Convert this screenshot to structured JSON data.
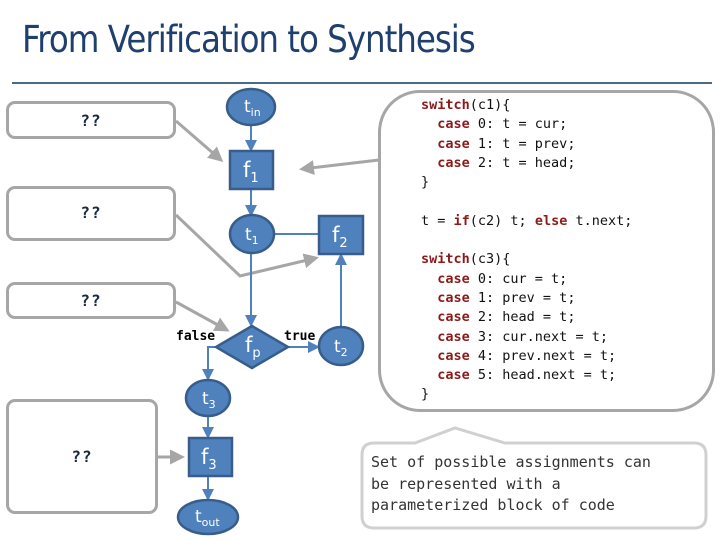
{
  "slide": {
    "title": "From Verification to Synthesis"
  },
  "holes": [
    {
      "label": "??"
    },
    {
      "label": "??"
    },
    {
      "label": "??"
    },
    {
      "label": "??"
    }
  ],
  "nodes": {
    "t_in": {
      "base": "t",
      "sub": "in"
    },
    "f1": {
      "base": "f",
      "sub": "1"
    },
    "t1": {
      "base": "t",
      "sub": "1"
    },
    "f2": {
      "base": "f",
      "sub": "2"
    },
    "fp": {
      "base": "f",
      "sub": "p"
    },
    "t2": {
      "base": "t",
      "sub": "2"
    },
    "t3": {
      "base": "t",
      "sub": "3"
    },
    "f3": {
      "base": "f",
      "sub": "3"
    },
    "t_out": {
      "base": "t",
      "sub": "out"
    }
  },
  "edge_labels": {
    "false": "false",
    "true": "true"
  },
  "code_block": {
    "lines": [
      [
        {
          "t": "switch",
          "kw": true
        },
        {
          "t": "(c1){"
        }
      ],
      [
        {
          "t": "  "
        },
        {
          "t": "case",
          "kw": true
        },
        {
          "t": " 0: t = cur;"
        }
      ],
      [
        {
          "t": "  "
        },
        {
          "t": "case",
          "kw": true
        },
        {
          "t": " 1: t = prev;"
        }
      ],
      [
        {
          "t": "  "
        },
        {
          "t": "case",
          "kw": true
        },
        {
          "t": " 2: t = head;"
        }
      ],
      [
        {
          "t": "}"
        }
      ],
      [
        {
          "t": ""
        }
      ],
      [
        {
          "t": "t = "
        },
        {
          "t": "if",
          "kw": true
        },
        {
          "t": "(c2) t; "
        },
        {
          "t": "else",
          "kw": true
        },
        {
          "t": " t.next;"
        }
      ],
      [
        {
          "t": ""
        }
      ],
      [
        {
          "t": "switch",
          "kw": true
        },
        {
          "t": "(c3){"
        }
      ],
      [
        {
          "t": "  "
        },
        {
          "t": "case",
          "kw": true
        },
        {
          "t": " 0: cur = t;"
        }
      ],
      [
        {
          "t": "  "
        },
        {
          "t": "case",
          "kw": true
        },
        {
          "t": " 1: prev = t;"
        }
      ],
      [
        {
          "t": "  "
        },
        {
          "t": "case",
          "kw": true
        },
        {
          "t": " 2: head = t;"
        }
      ],
      [
        {
          "t": "  "
        },
        {
          "t": "case",
          "kw": true
        },
        {
          "t": " 3: cur.next = t;"
        }
      ],
      [
        {
          "t": "  "
        },
        {
          "t": "case",
          "kw": true
        },
        {
          "t": " 4: prev.next = t;"
        }
      ],
      [
        {
          "t": "  "
        },
        {
          "t": "case",
          "kw": true
        },
        {
          "t": " 5: head.next = t;"
        }
      ],
      [
        {
          "t": "}"
        }
      ]
    ]
  },
  "callout": {
    "text": "Set of possible assignments can\nbe represented with a\nparameterized block of code"
  },
  "colors": {
    "node_fill": "#4f81bd",
    "node_stroke": "#385d8a",
    "keyword": "#8b1a1a",
    "title": "#1f3f6e",
    "connector": "#a6a6a6"
  }
}
